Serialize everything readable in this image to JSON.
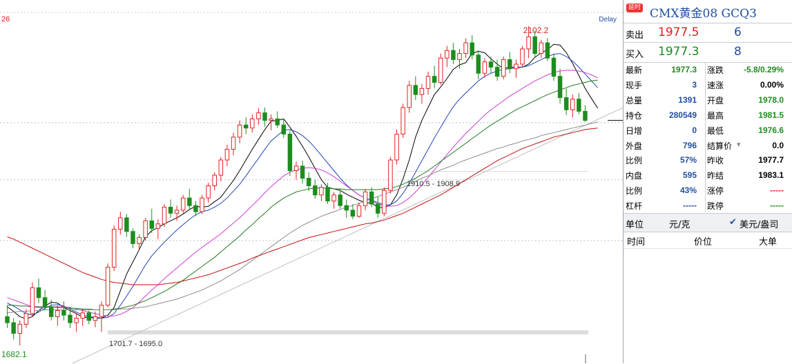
{
  "chart_data": {
    "type": "candlestick",
    "instrument": "CMX黄金08  GCQ3",
    "delay_label": "Delay",
    "corner_label": "26",
    "annotations": {
      "high": "2102.2",
      "low": "1682.1",
      "range_low": "1701.7 - 1695.0",
      "range_mid": "1910.5 - 1908.9"
    },
    "ylim": [
      1665,
      2120
    ],
    "h_lines": [
      1975,
      1900,
      1820
    ],
    "ohlc": [
      [
        1720,
        1735,
        1705,
        1712
      ],
      [
        1712,
        1718,
        1690,
        1698
      ],
      [
        1698,
        1715,
        1682,
        1710
      ],
      [
        1710,
        1730,
        1705,
        1724
      ],
      [
        1724,
        1765,
        1720,
        1758
      ],
      [
        1758,
        1770,
        1738,
        1745
      ],
      [
        1745,
        1755,
        1728,
        1733
      ],
      [
        1733,
        1742,
        1715,
        1720
      ],
      [
        1720,
        1735,
        1708,
        1728
      ],
      [
        1728,
        1740,
        1715,
        1722
      ],
      [
        1722,
        1733,
        1705,
        1712
      ],
      [
        1712,
        1724,
        1700,
        1718
      ],
      [
        1718,
        1730,
        1708,
        1725
      ],
      [
        1725,
        1728,
        1710,
        1715
      ],
      [
        1715,
        1727,
        1706,
        1720
      ],
      [
        1720,
        1740,
        1700,
        1735
      ],
      [
        1735,
        1790,
        1732,
        1785
      ],
      [
        1785,
        1840,
        1780,
        1835
      ],
      [
        1835,
        1858,
        1828,
        1850
      ],
      [
        1850,
        1855,
        1825,
        1832
      ],
      [
        1832,
        1836,
        1810,
        1816
      ],
      [
        1816,
        1828,
        1808,
        1824
      ],
      [
        1824,
        1850,
        1820,
        1846
      ],
      [
        1846,
        1862,
        1830,
        1836
      ],
      [
        1836,
        1848,
        1822,
        1842
      ],
      [
        1842,
        1868,
        1838,
        1864
      ],
      [
        1864,
        1874,
        1850,
        1856
      ],
      [
        1856,
        1866,
        1846,
        1860
      ],
      [
        1860,
        1880,
        1855,
        1876
      ],
      [
        1876,
        1888,
        1860,
        1866
      ],
      [
        1866,
        1872,
        1852,
        1858
      ],
      [
        1858,
        1880,
        1855,
        1876
      ],
      [
        1876,
        1896,
        1870,
        1892
      ],
      [
        1892,
        1910,
        1886,
        1906
      ],
      [
        1906,
        1930,
        1898,
        1926
      ],
      [
        1926,
        1946,
        1918,
        1940
      ],
      [
        1940,
        1962,
        1932,
        1956
      ],
      [
        1956,
        1978,
        1948,
        1972
      ],
      [
        1972,
        1982,
        1960,
        1968
      ],
      [
        1968,
        1986,
        1962,
        1980
      ],
      [
        1980,
        1994,
        1972,
        1988
      ],
      [
        1988,
        1995,
        1970,
        1978
      ],
      [
        1978,
        1986,
        1965,
        1980
      ],
      [
        1980,
        1990,
        1968,
        1972
      ],
      [
        1972,
        1980,
        1955,
        1960
      ],
      [
        1960,
        1965,
        1905,
        1912
      ],
      [
        1912,
        1924,
        1900,
        1918
      ],
      [
        1918,
        1925,
        1895,
        1902
      ],
      [
        1902,
        1910,
        1885,
        1892
      ],
      [
        1892,
        1900,
        1875,
        1880
      ],
      [
        1880,
        1894,
        1872,
        1890
      ],
      [
        1890,
        1896,
        1868,
        1872
      ],
      [
        1872,
        1884,
        1862,
        1880
      ],
      [
        1880,
        1888,
        1862,
        1866
      ],
      [
        1866,
        1874,
        1850,
        1860
      ],
      [
        1860,
        1868,
        1848,
        1852
      ],
      [
        1852,
        1870,
        1850,
        1866
      ],
      [
        1866,
        1888,
        1860,
        1884
      ],
      [
        1884,
        1890,
        1864,
        1868
      ],
      [
        1868,
        1878,
        1850,
        1856
      ],
      [
        1856,
        1890,
        1852,
        1886
      ],
      [
        1886,
        1930,
        1882,
        1926
      ],
      [
        1926,
        1966,
        1920,
        1960
      ],
      [
        1960,
        2000,
        1955,
        1995
      ],
      [
        1995,
        2030,
        1988,
        2024
      ],
      [
        2024,
        2036,
        2005,
        2012
      ],
      [
        2012,
        2026,
        2000,
        2020
      ],
      [
        2020,
        2042,
        2012,
        2036
      ],
      [
        2036,
        2050,
        2020,
        2028
      ],
      [
        2028,
        2066,
        2025,
        2060
      ],
      [
        2060,
        2076,
        2048,
        2070
      ],
      [
        2070,
        2080,
        2052,
        2058
      ],
      [
        2058,
        2072,
        2046,
        2066
      ],
      [
        2066,
        2086,
        2060,
        2080
      ],
      [
        2080,
        2090,
        2058,
        2064
      ],
      [
        2064,
        2070,
        2032,
        2040
      ],
      [
        2040,
        2060,
        2034,
        2055
      ],
      [
        2055,
        2062,
        2040,
        2048
      ],
      [
        2048,
        2058,
        2030,
        2036
      ],
      [
        2036,
        2062,
        2032,
        2058
      ],
      [
        2058,
        2068,
        2040,
        2046
      ],
      [
        2046,
        2058,
        2034,
        2052
      ],
      [
        2052,
        2076,
        2048,
        2072
      ],
      [
        2072,
        2102,
        2060,
        2088
      ],
      [
        2088,
        2096,
        2060,
        2066
      ],
      [
        2066,
        2084,
        2060,
        2080
      ],
      [
        2080,
        2086,
        2056,
        2060
      ],
      [
        2060,
        2066,
        2030,
        2036
      ],
      [
        2036,
        2046,
        2000,
        2008
      ],
      [
        2008,
        2020,
        1985,
        1992
      ],
      [
        1992,
        2012,
        1982,
        2006
      ],
      [
        2006,
        2014,
        1986,
        1990
      ],
      [
        1990,
        1998,
        1976,
        1978
      ]
    ],
    "ma": [
      {
        "color": "#000000",
        "values": [
          1733,
          1727,
          1720,
          1717,
          1720,
          1728,
          1734,
          1739,
          1738,
          1732,
          1728,
          1724,
          1719,
          1719,
          1718,
          1718,
          1722,
          1732,
          1754,
          1776,
          1792,
          1808,
          1825,
          1833,
          1837,
          1842,
          1846,
          1850,
          1855,
          1861,
          1865,
          1864,
          1865,
          1871,
          1877,
          1888,
          1899,
          1912,
          1926,
          1940,
          1953,
          1966,
          1977,
          1978,
          1980,
          1969,
          1957,
          1944,
          1930,
          1915,
          1900,
          1890,
          1888,
          1886,
          1881,
          1877,
          1873,
          1870,
          1869,
          1864,
          1863,
          1867,
          1880,
          1901,
          1926,
          1956,
          1978,
          1995,
          2012,
          2022,
          2033,
          2045,
          2051,
          2054,
          2066,
          2069,
          2067,
          2059,
          2052,
          2046,
          2048,
          2048,
          2048,
          2052,
          2061,
          2067,
          2071,
          2078,
          2077,
          2067,
          2053,
          2037,
          2020,
          2007,
          1994
        ]
      },
      {
        "color": "#1f45b3",
        "values": [
          1738,
          1734,
          1729,
          1724,
          1722,
          1726,
          1731,
          1735,
          1736,
          1734,
          1730,
          1726,
          1722,
          1720,
          1719,
          1718,
          1719,
          1724,
          1735,
          1747,
          1760,
          1774,
          1788,
          1800,
          1809,
          1818,
          1826,
          1834,
          1841,
          1848,
          1854,
          1858,
          1860,
          1864,
          1869,
          1876,
          1885,
          1894,
          1905,
          1917,
          1928,
          1940,
          1951,
          1958,
          1965,
          1966,
          1963,
          1958,
          1951,
          1942,
          1932,
          1922,
          1912,
          1902,
          1893,
          1886,
          1880,
          1876,
          1873,
          1870,
          1867,
          1867,
          1872,
          1882,
          1895,
          1910,
          1925,
          1940,
          1955,
          1969,
          1983,
          1996,
          2006,
          2014,
          2022,
          2030,
          2036,
          2040,
          2043,
          2045,
          2046,
          2047,
          2048,
          2050,
          2054,
          2058,
          2062,
          2065,
          2066,
          2062,
          2056,
          2048,
          2039,
          2030,
          2021
        ]
      },
      {
        "color": "#d23ad2",
        "values": [
          1745,
          1742,
          1739,
          1736,
          1733,
          1732,
          1732,
          1733,
          1733,
          1733,
          1732,
          1730,
          1728,
          1726,
          1724,
          1722,
          1721,
          1721,
          1723,
          1727,
          1732,
          1739,
          1747,
          1755,
          1762,
          1770,
          1777,
          1784,
          1791,
          1798,
          1805,
          1811,
          1817,
          1823,
          1829,
          1836,
          1843,
          1850,
          1858,
          1866,
          1874,
          1883,
          1891,
          1898,
          1905,
          1910,
          1913,
          1915,
          1916,
          1915,
          1913,
          1909,
          1904,
          1898,
          1892,
          1886,
          1880,
          1876,
          1872,
          1868,
          1866,
          1865,
          1866,
          1870,
          1876,
          1884,
          1893,
          1903,
          1913,
          1923,
          1933,
          1943,
          1952,
          1961,
          1969,
          1977,
          1985,
          1992,
          1998,
          2004,
          2010,
          2015,
          2020,
          2025,
          2030,
          2034,
          2038,
          2041,
          2043,
          2044,
          2044,
          2043,
          2041,
          2038,
          2034
        ]
      },
      {
        "color": "#1e7a1e",
        "values": [
          1735,
          1735,
          1734,
          1734,
          1733,
          1733,
          1733,
          1733,
          1732,
          1732,
          1731,
          1731,
          1730,
          1730,
          1729,
          1729,
          1729,
          1730,
          1731,
          1733,
          1735,
          1738,
          1741,
          1745,
          1749,
          1753,
          1758,
          1763,
          1768,
          1774,
          1780,
          1786,
          1792,
          1798,
          1805,
          1812,
          1819,
          1826,
          1834,
          1841,
          1849,
          1856,
          1864,
          1870,
          1876,
          1880,
          1884,
          1886,
          1888,
          1889,
          1889,
          1889,
          1888,
          1888,
          1887,
          1887,
          1887,
          1887,
          1887,
          1887,
          1888,
          1889,
          1891,
          1894,
          1898,
          1902,
          1907,
          1912,
          1918,
          1924,
          1930,
          1936,
          1942,
          1948,
          1954,
          1960,
          1966,
          1972,
          1977,
          1982,
          1987,
          1992,
          1996,
          2000,
          2004,
          2008,
          2012,
          2015,
          2018,
          2021,
          2024,
          2026,
          2028,
          2030,
          2031
        ]
      },
      {
        "color": "#8c8c8c",
        "values": [
          1725,
          1726,
          1727,
          1727,
          1728,
          1728,
          1729,
          1729,
          1729,
          1729,
          1729,
          1729,
          1729,
          1729,
          1729,
          1729,
          1729,
          1729,
          1730,
          1730,
          1731,
          1732,
          1733,
          1735,
          1737,
          1739,
          1741,
          1743,
          1746,
          1749,
          1752,
          1755,
          1759,
          1763,
          1767,
          1772,
          1777,
          1782,
          1788,
          1794,
          1800,
          1806,
          1812,
          1818,
          1824,
          1830,
          1835,
          1840,
          1844,
          1848,
          1852,
          1855,
          1858,
          1861,
          1864,
          1866,
          1869,
          1872,
          1875,
          1878,
          1881,
          1884,
          1887,
          1890,
          1894,
          1898,
          1902,
          1905,
          1909,
          1913,
          1916,
          1919,
          1923,
          1926,
          1929,
          1932,
          1935,
          1938,
          1941,
          1943,
          1946,
          1948,
          1951,
          1953,
          1955,
          1958,
          1960,
          1962,
          1964,
          1966,
          1968,
          1970,
          1972,
          1974,
          1976
        ]
      },
      {
        "color": "#c01010",
        "values": [
          1825,
          1822,
          1818,
          1814,
          1810,
          1806,
          1802,
          1798,
          1794,
          1790,
          1786,
          1782,
          1778,
          1775,
          1772,
          1769,
          1767,
          1765,
          1764,
          1763,
          1762,
          1762,
          1762,
          1762,
          1762,
          1763,
          1764,
          1765,
          1767,
          1769,
          1771,
          1773,
          1775,
          1778,
          1781,
          1784,
          1787,
          1790,
          1793,
          1797,
          1800,
          1803,
          1806,
          1809,
          1812,
          1815,
          1818,
          1821,
          1824,
          1826,
          1828,
          1830,
          1832,
          1834,
          1836,
          1838,
          1840,
          1842,
          1843,
          1845,
          1847,
          1850,
          1853,
          1856,
          1860,
          1864,
          1868,
          1872,
          1876,
          1880,
          1885,
          1890,
          1895,
          1900,
          1905,
          1910,
          1915,
          1920,
          1925,
          1929,
          1933,
          1937,
          1941,
          1944,
          1947,
          1950,
          1953,
          1956,
          1958,
          1960,
          1962,
          1964,
          1966,
          1967,
          1968
        ]
      }
    ]
  },
  "panel": {
    "badge": "延时",
    "title": "CMX黄金08  GCQ3",
    "ask_label": "卖出",
    "ask_price": "1977.5",
    "ask_vol": "6",
    "bid_label": "买入",
    "bid_price": "1977.3",
    "bid_vol": "8",
    "stats": [
      {
        "l1": "最新",
        "v1": "1977.3",
        "c1": "#1e8c1e",
        "l2": "涨跌",
        "v2": "-5.8/0.29%",
        "c2": "#1e8c1e"
      },
      {
        "l1": "现手",
        "v1": "3",
        "c1": "#1f4e9e",
        "l2": "速涨",
        "v2": "0.00%",
        "c2": "#000000"
      },
      {
        "l1": "总量",
        "v1": "1391",
        "c1": "#1f4e9e",
        "l2": "开盘",
        "v2": "1978.0",
        "c2": "#1e8c1e"
      },
      {
        "l1": "持仓",
        "v1": "280549",
        "c1": "#1f4e9e",
        "l2": "最高",
        "v2": "1981.5",
        "c2": "#1e8c1e"
      },
      {
        "l1": "日增",
        "v1": "0",
        "c1": "#1f4e9e",
        "l2": "最低",
        "v2": "1976.6",
        "c2": "#1e8c1e"
      },
      {
        "l1": "外盘",
        "v1": "796",
        "c1": "#1f4e9e",
        "l2": "结算价",
        "v2": "0.0",
        "c2": "#000000"
      },
      {
        "l1": "比例",
        "v1": "57%",
        "c1": "#1f4e9e",
        "l2": "昨收",
        "v2": "1977.7",
        "c2": "#000000"
      },
      {
        "l1": "内盘",
        "v1": "595",
        "c1": "#1f4e9e",
        "l2": "昨结",
        "v2": "1983.1",
        "c2": "#000000"
      },
      {
        "l1": "比例",
        "v1": "43%",
        "c1": "#1f4e9e",
        "l2": "涨停",
        "v2": "-----",
        "c2": "#e02020"
      },
      {
        "l1": "杠杆",
        "v1": "-----",
        "c1": "#1f4e9e",
        "l2": "跌停",
        "v2": "-----",
        "c2": "#1e8c1e"
      }
    ],
    "unit_label": "单位",
    "unit_value": "元/克",
    "unit_alt": "美元/盎司",
    "check": "✔",
    "col_time": "时间",
    "col_price": "价位",
    "col_big": "大单"
  },
  "colors": {
    "up": "#e02020",
    "down": "#1e8c1e"
  }
}
